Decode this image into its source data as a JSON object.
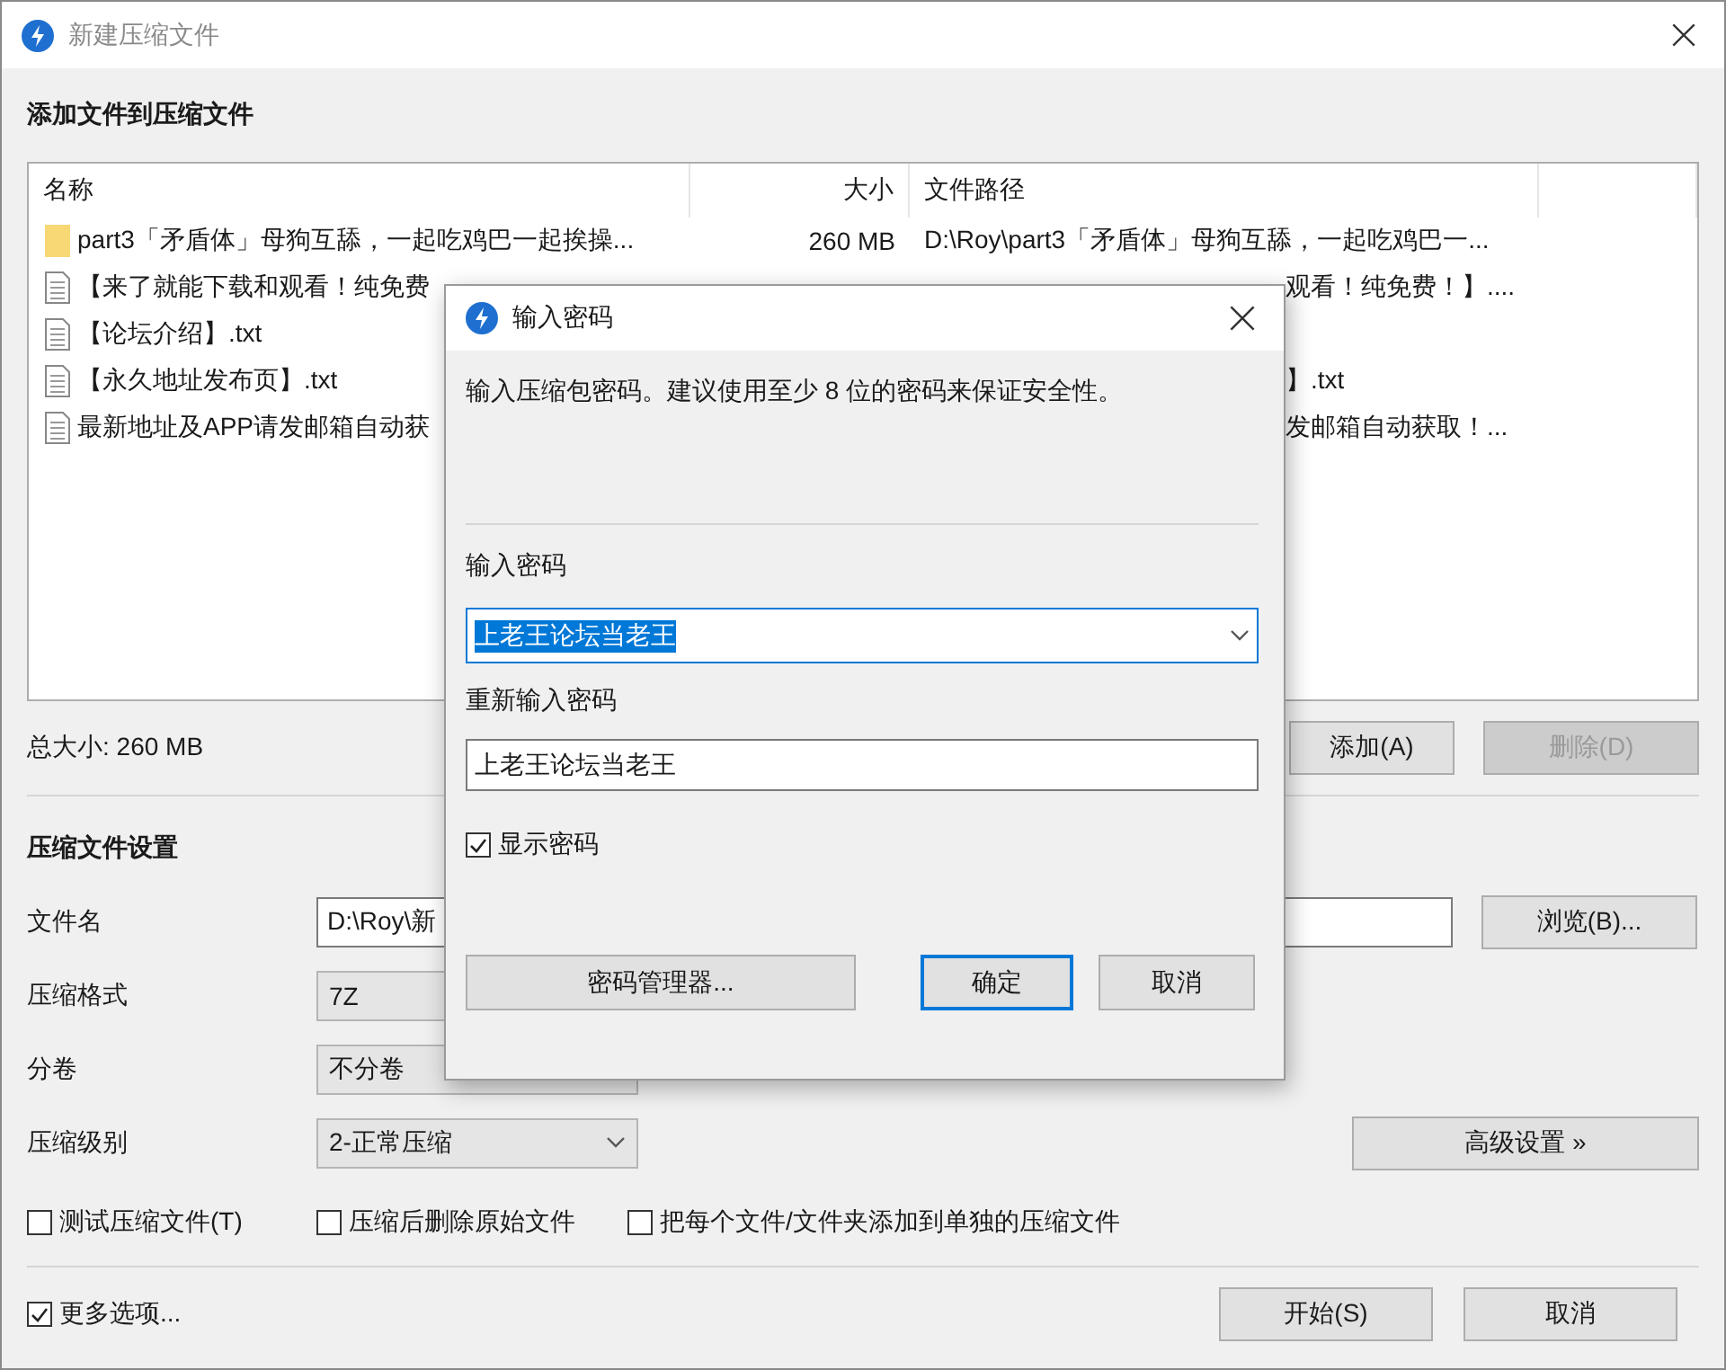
{
  "window": {
    "title": "新建压缩文件"
  },
  "add_section": {
    "title": "添加文件到压缩文件"
  },
  "file_list": {
    "columns": [
      "名称",
      "大小",
      "文件路径"
    ],
    "rows": [
      {
        "kind": "folder",
        "name": "part3「矛盾体」母狗互舔，一起吃鸡巴一起挨操...",
        "size": "260 MB",
        "path": "D:\\Roy\\part3「矛盾体」母狗互舔，一起吃鸡巴一...",
        "path_start_hidden": false
      },
      {
        "kind": "file",
        "name": "【来了就能下载和观看！纯免费",
        "path": "观看！纯免费！】....",
        "path_start_hidden": true
      },
      {
        "kind": "file",
        "name": "【论坛介绍】.txt"
      },
      {
        "kind": "file",
        "name": "【永久地址发布页】.txt",
        "path": "】.txt",
        "path_start_hidden": true
      },
      {
        "kind": "file",
        "name": "最新地址及APP请发邮箱自动获",
        "path": "发邮箱自动获取！...",
        "path_start_hidden": true
      }
    ]
  },
  "total_size": "总大小: 260 MB",
  "list_buttons": [
    {
      "label": "添加(A)",
      "disabled": false
    },
    {
      "label": "删除(D)",
      "disabled": true
    }
  ],
  "settings": {
    "title": "压缩文件设置",
    "fields": [
      {
        "kind": "text",
        "label": "文件名",
        "value": "D:\\Roy\\新"
      },
      {
        "kind": "box",
        "label": "压缩格式",
        "value": "7Z"
      },
      {
        "kind": "box",
        "label": "分卷",
        "value": "不分卷"
      },
      {
        "kind": "select",
        "label": "压缩级别",
        "value": "2-正常压缩"
      }
    ],
    "browse_button": "浏览(B)...",
    "advanced_button": "高级设置 »",
    "options": [
      {
        "label": "测试压缩文件(T)",
        "checked": false
      },
      {
        "label": "压缩后删除原始文件",
        "checked": false
      },
      {
        "label": "把每个文件/文件夹添加到单独的压缩文件",
        "checked": false
      }
    ]
  },
  "more_options": {
    "label": "更多选项...",
    "checked": true
  },
  "footer_buttons": [
    "开始(S)",
    "取消"
  ],
  "dialog": {
    "title": "输入密码",
    "message": "输入压缩包密码。建议使用至少 8 位的密码来保证安全性。",
    "password_label": "输入密码",
    "password": "上老王论坛当老王",
    "password_selected": true,
    "confirm_label": "重新输入密码",
    "confirm": "上老王论坛当老王",
    "show_password": {
      "label": "显示密码",
      "checked": true
    },
    "buttons": [
      {
        "label": "密码管理器...",
        "kind": "manager"
      },
      {
        "label": "确定",
        "kind": "default"
      },
      {
        "label": "取消",
        "kind": "cancel"
      }
    ]
  }
}
